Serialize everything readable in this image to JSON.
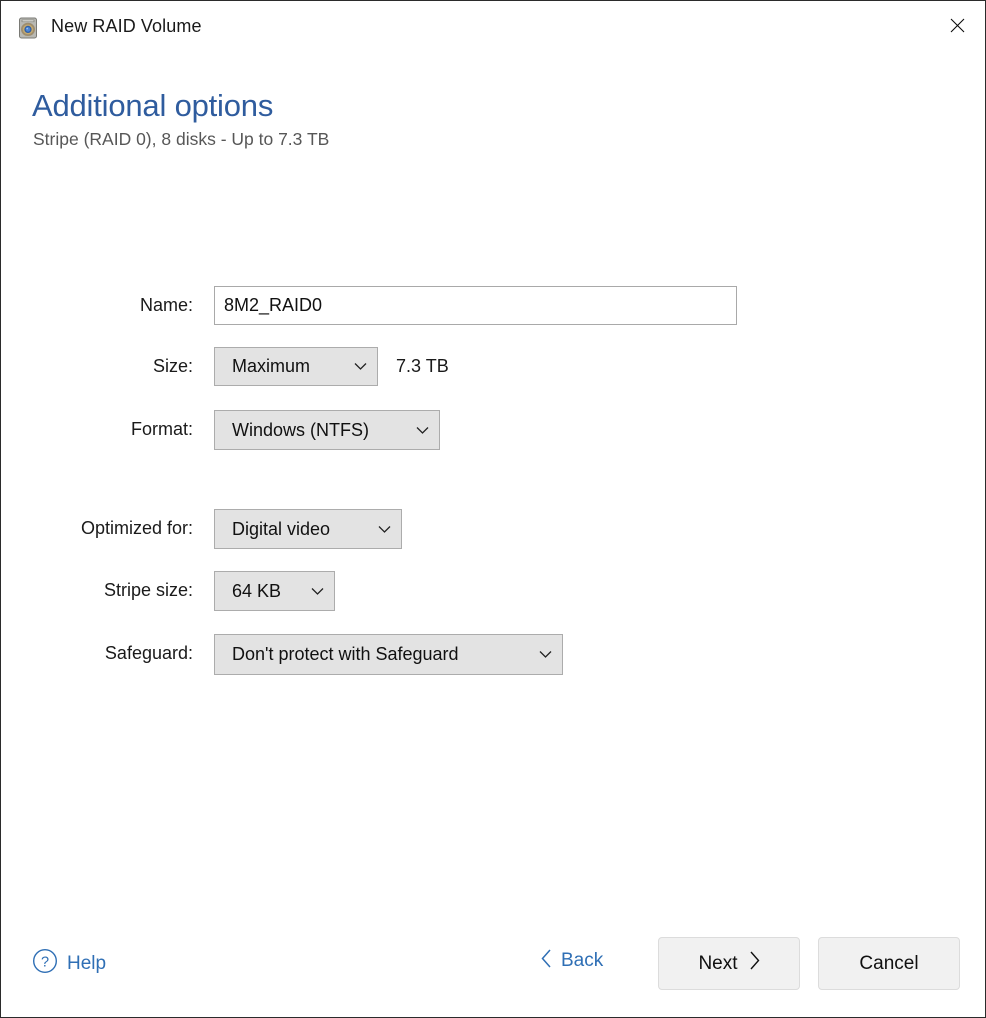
{
  "window": {
    "title": "New RAID Volume",
    "icon": "raid-volume-icon",
    "close_icon": "close-icon",
    "border_color": "#2b2b2b",
    "background": "#ffffff"
  },
  "header": {
    "heading": "Additional options",
    "subheading": "Stripe (RAID 0), 8 disks - Up to 7.3 TB",
    "heading_color": "#2f5c9e",
    "subheading_color": "#575757"
  },
  "form": {
    "fields": [
      {
        "key": "name",
        "label": "Name:",
        "type": "text",
        "value": "8M2_RAID0",
        "placeholder": ""
      },
      {
        "key": "size",
        "label": "Size:",
        "type": "dropdown",
        "value": "Maximum",
        "suffix": "7.3 TB",
        "arrow_icon": "chevron-down-icon"
      },
      {
        "key": "format",
        "label": "Format:",
        "type": "dropdown",
        "value": "Windows (NTFS)",
        "arrow_icon": "chevron-down-icon"
      },
      {
        "key": "optimized_for",
        "label": "Optimized for:",
        "type": "dropdown",
        "value": "Digital video",
        "arrow_icon": "chevron-down-icon"
      },
      {
        "key": "stripe_size",
        "label": "Stripe size:",
        "type": "dropdown",
        "value": "64 KB",
        "arrow_icon": "chevron-down-icon"
      },
      {
        "key": "safeguard",
        "label": "Safeguard:",
        "type": "dropdown",
        "value": "Don't protect with Safeguard",
        "arrow_icon": "chevron-down-icon"
      }
    ]
  },
  "footer": {
    "help_label": "Help",
    "help_icon": "question-circle-icon",
    "back_label": "Back",
    "back_icon": "chevron-left-icon",
    "next_label": "Next",
    "next_icon": "chevron-right-icon",
    "cancel_label": "Cancel",
    "link_color": "#2f6fb5"
  }
}
